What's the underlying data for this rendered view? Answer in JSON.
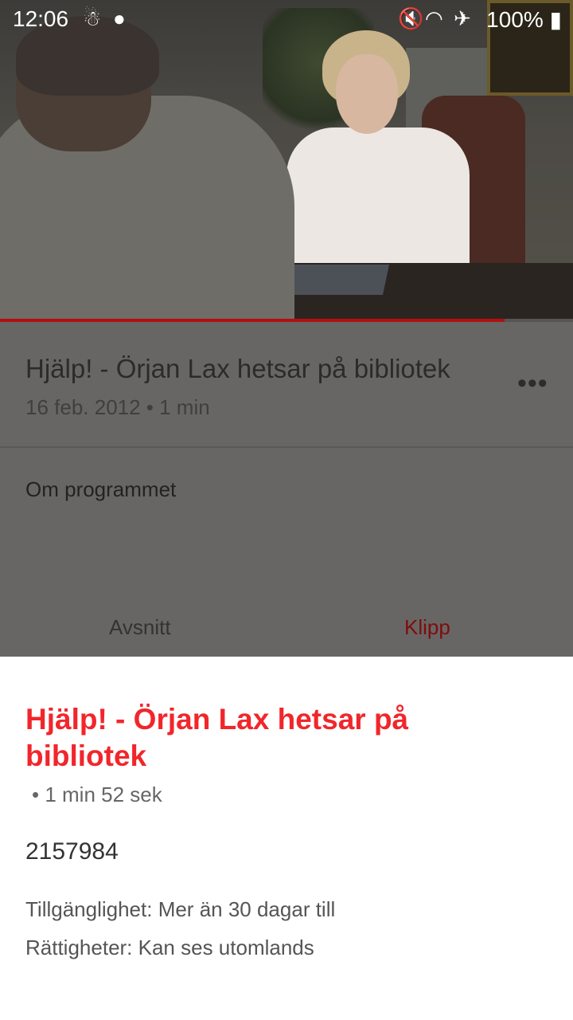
{
  "status_bar": {
    "time": "12:06",
    "battery": "100%"
  },
  "video": {
    "progress": 0.88
  },
  "program": {
    "title": "Hjälp! - Örjan Lax hetsar på bibliotek",
    "meta": "16 feb. 2012 • 1 min",
    "more": "•••",
    "about_label": "Om programmet"
  },
  "tabs": {
    "episodes": "Avsnitt",
    "clips": "Klipp"
  },
  "clip_sheet": {
    "title": "Hjälp! - Örjan Lax hetsar på bibliotek",
    "duration": "• 1 min 52 sek",
    "id": "2157984",
    "availability": "Tillgänglighet: Mer än 30 dagar till",
    "rights": "Rättigheter: Kan ses utomlands"
  },
  "colors": {
    "accent_red": "#f1262b",
    "progress_red": "#b01010",
    "active_tab": "#7d0d0d"
  }
}
